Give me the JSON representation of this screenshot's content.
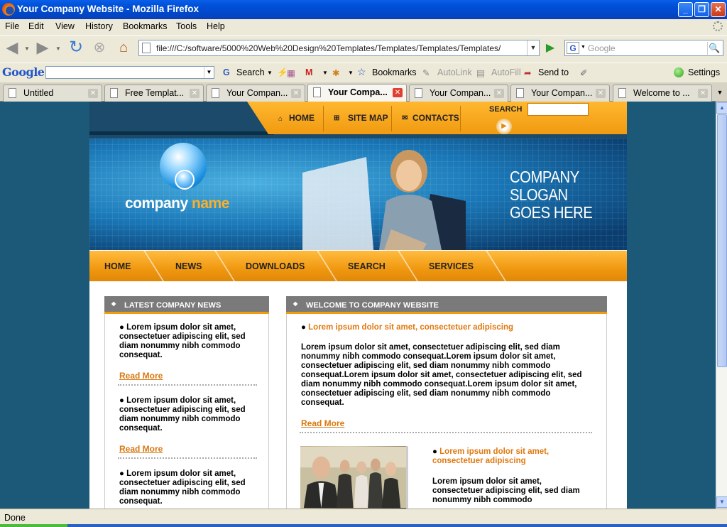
{
  "window": {
    "title": "Your Company Website - Mozilla Firefox",
    "min": "_",
    "max": "❐",
    "close": "✕"
  },
  "menu": [
    "File",
    "Edit",
    "View",
    "History",
    "Bookmarks",
    "Tools",
    "Help"
  ],
  "nav": {
    "url": "file:///C:/software/5000%20Web%20Design%20Templates/Templates/Templates/Templates/",
    "search_placeholder": "Google"
  },
  "google_toolbar": {
    "logo": "Google",
    "search": "Search",
    "bookmarks": "Bookmarks",
    "autolink": "AutoLink",
    "autofill": "AutoFill",
    "sendto": "Send to",
    "settings": "Settings"
  },
  "tabs": [
    {
      "title": "Untitled"
    },
    {
      "title": "Free Templat..."
    },
    {
      "title": "Your Compan..."
    },
    {
      "title": "Your Compa..."
    },
    {
      "title": "Your Compan..."
    },
    {
      "title": "Your Compan..."
    },
    {
      "title": "Welcome to ..."
    }
  ],
  "status": {
    "text": "Done"
  },
  "site": {
    "topnav": {
      "home": "HOME",
      "sitemap": "SITE MAP",
      "contacts": "CONTACTS",
      "search_label": "SEARCH"
    },
    "logo": {
      "company": "company",
      "name": "name"
    },
    "slogan": [
      "COMPANY",
      "SLOGAN",
      "GOES HERE"
    ],
    "mainnav": [
      "HOME",
      "NEWS",
      "DOWNLOADS",
      "SEARCH",
      "SERVICES"
    ],
    "news": {
      "title": "LATEST COMPANY NEWS",
      "items": [
        {
          "text": "Lorem ipsum dolor sit amet, consectetuer adipiscing elit, sed diam nonummy nibh commodo consequat.",
          "link": "Read More"
        },
        {
          "text": "Lorem ipsum dolor sit amet, consectetuer adipiscing elit, sed diam nonummy nibh commodo consequat.",
          "link": "Read More"
        },
        {
          "text": "Lorem ipsum dolor sit amet, consectetuer adipiscing elit, sed diam nonummy nibh commodo consequat."
        }
      ]
    },
    "welcome": {
      "title": "WELCOME TO COMPANY WEBSITE",
      "headline": "Lorem ipsum dolor sit amet, consectetuer adipiscing",
      "body": "Lorem ipsum dolor sit amet, consectetuer adipiscing elit, sed diam nonummy nibh commodo consequat.Lorem ipsum dolor sit amet, consectetuer adipiscing elit, sed diam nonummy nibh commodo consequat.Lorem ipsum dolor sit amet, consectetuer adipiscing elit, sed diam nonummy nibh commodo consequat.Lorem ipsum dolor sit amet, consectetuer adipiscing elit, sed diam nonummy nibh commodo consequat.",
      "link": "Read More",
      "headline2": "Lorem ipsum dolor sit amet, consectetuer adipiscing",
      "body2": "Lorem ipsum dolor sit amet, consectetuer adipiscing elit, sed diam nonummy nibh commodo"
    }
  }
}
